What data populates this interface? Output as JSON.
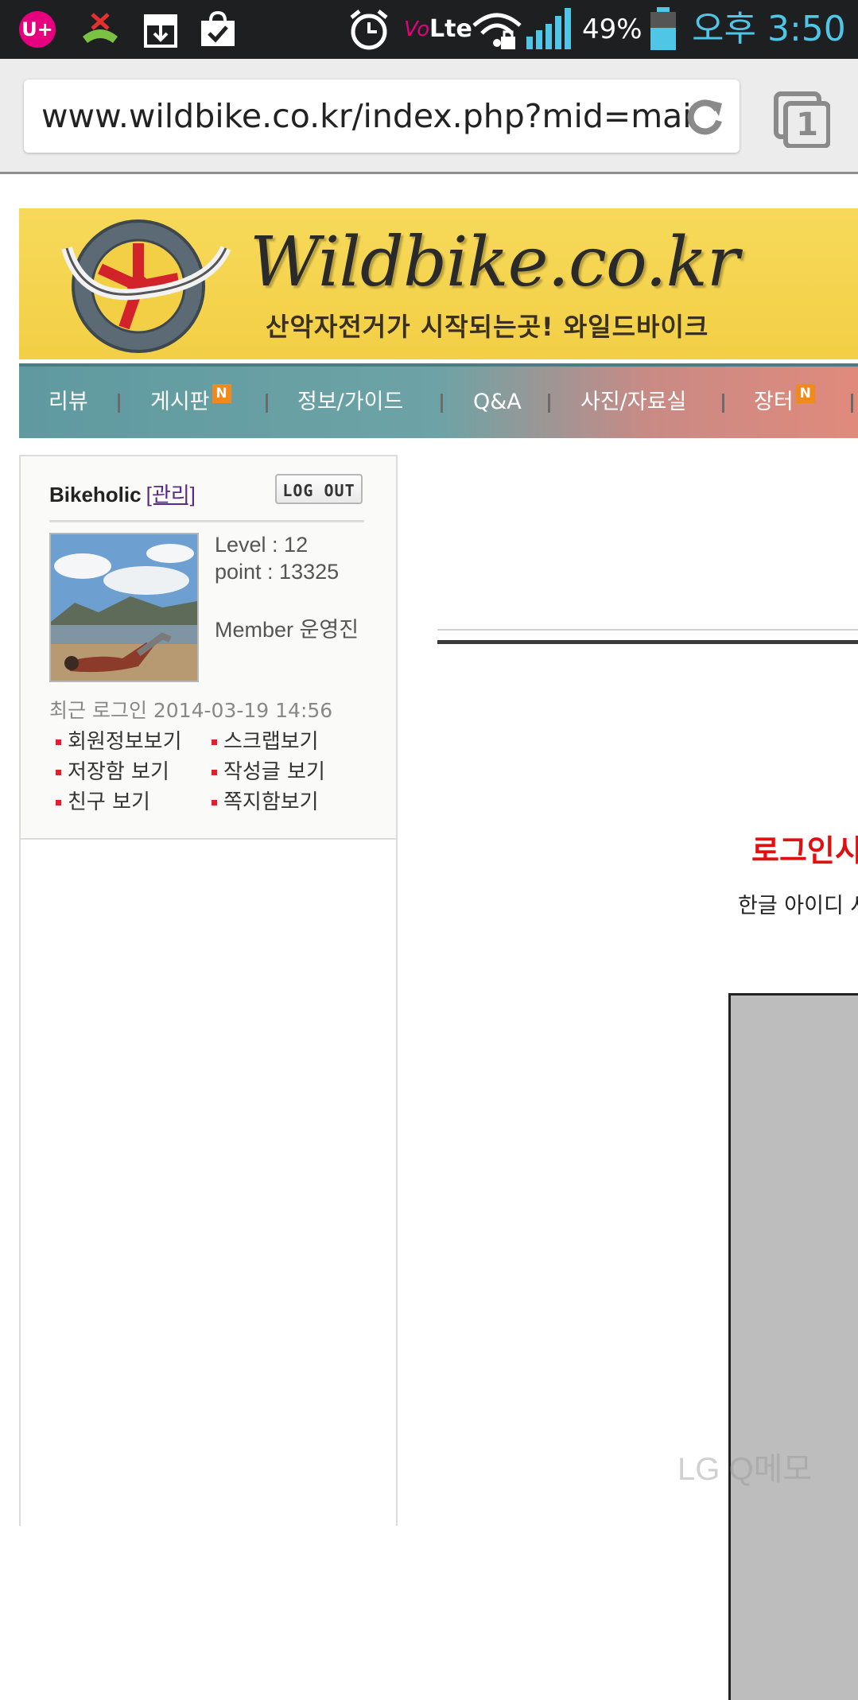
{
  "statusbar": {
    "battery_percent": "49%",
    "time": "오후 3:50",
    "network_label": "Lte",
    "volte_label": "Vo",
    "accent_color": "#4fc6e6"
  },
  "browser": {
    "url": "www.wildbike.co.kr/index.php?mid=main",
    "tab_count": "1"
  },
  "banner": {
    "logo": "Wildbike.co.kr",
    "tagline": "산악자전거가 시작되는곳! 와일드바이크"
  },
  "nav": {
    "items": [
      {
        "label": "리뷰",
        "badge": ""
      },
      {
        "label": "게시판",
        "badge": "N"
      },
      {
        "label": "정보/가이드",
        "badge": ""
      },
      {
        "label": "Q&A",
        "badge": ""
      },
      {
        "label": "사진/자료실",
        "badge": ""
      },
      {
        "label": "장터",
        "badge": "N"
      }
    ]
  },
  "login": {
    "username": "Bikeholic",
    "admin_link": "[관리]",
    "logout_label": "LOG OUT",
    "level": "Level : 12",
    "point": "point : 13325",
    "member": "Member 운영진",
    "last_login": "최근 로그인 2014-03-19 14:56",
    "links": [
      "회원정보보기",
      "스크랩보기",
      "저장함 보기",
      "작성글 보기",
      "친구 보기",
      "쪽지함보기"
    ]
  },
  "content": {
    "login_message": "로그인시",
    "login_subtext": "한글 아이디 사"
  },
  "watermark": "LG Q메모"
}
